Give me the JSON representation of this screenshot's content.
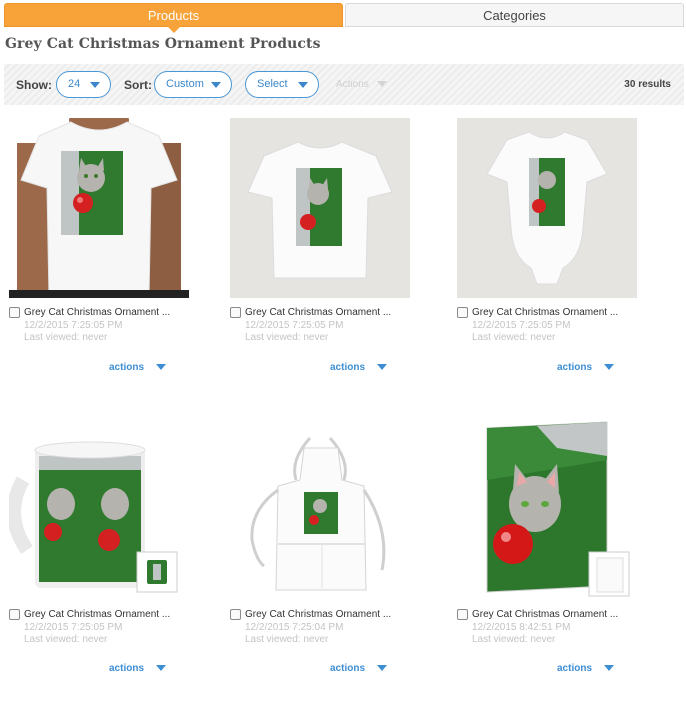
{
  "tabs": {
    "products": "Products",
    "categories": "Categories"
  },
  "page_title": "Grey Cat Christmas Ornament Products",
  "toolbar": {
    "show_label": "Show:",
    "show_value": "24",
    "sort_label": "Sort:",
    "sort_value": "Custom",
    "select_label": "Select",
    "actions_label": "Actions",
    "results": "30 results"
  },
  "products": [
    {
      "name": "Grey Cat Christmas Ornament ...",
      "date": "12/2/2015 7:25:05 PM",
      "viewed": "Last viewed: never",
      "actions": "actions",
      "type": "kids-tshirt"
    },
    {
      "name": "Grey Cat Christmas Ornament ...",
      "date": "12/2/2015 7:25:05 PM",
      "viewed": "Last viewed: never",
      "actions": "actions",
      "type": "toddler-tshirt"
    },
    {
      "name": "Grey Cat Christmas Ornament ...",
      "date": "12/2/2015 7:25:05 PM",
      "viewed": "Last viewed: never",
      "actions": "actions",
      "type": "baby-bodysuit"
    },
    {
      "name": "Grey Cat Christmas Ornament ...",
      "date": "12/2/2015 7:25:05 PM",
      "viewed": "Last viewed: never",
      "actions": "actions",
      "type": "mug"
    },
    {
      "name": "Grey Cat Christmas Ornament ...",
      "date": "12/2/2015 7:25:04 PM",
      "viewed": "Last viewed: never",
      "actions": "actions",
      "type": "apron"
    },
    {
      "name": "Grey Cat Christmas Ornament ...",
      "date": "12/2/2015 8:42:51 PM",
      "viewed": "Last viewed: never",
      "actions": "actions",
      "type": "greeting-card"
    }
  ],
  "colors": {
    "accent": "#f7a33a",
    "link": "#3d8ed3",
    "muted": "#c4c4c4"
  }
}
